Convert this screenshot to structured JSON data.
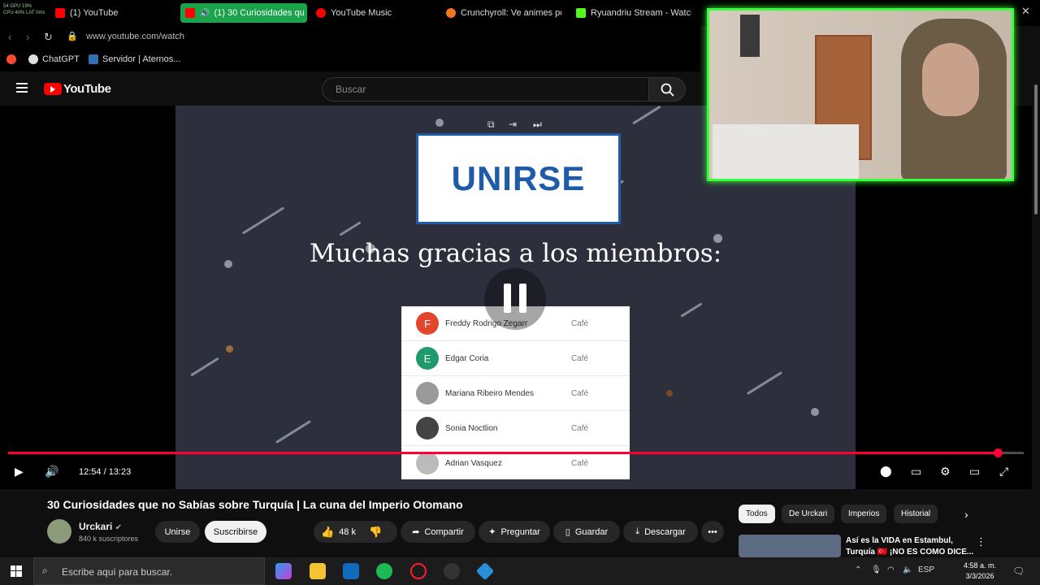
{
  "browser": {
    "tabs": [
      {
        "label": "(1) YouTube",
        "color": "#ff0000"
      },
      {
        "label": "(1) 30 Curiosidades qu",
        "color": "#ff0000",
        "active": true
      },
      {
        "label": "YouTube Music",
        "color": "#ff0000"
      },
      {
        "label": "Crunchyroll: Ve animes po",
        "color": "#f47521"
      },
      {
        "label": "Ryuandriu Stream - Watch",
        "color": "#53fc18"
      }
    ],
    "sysmon": [
      "54  GPU 19%",
      "CPU 40%  LAT 0ms"
    ],
    "url": "www.youtube.com/watch",
    "bookmarks": [
      "ChatGPT",
      "Servidor | Aternos..."
    ]
  },
  "youtube": {
    "logo_text": "YouTube",
    "search_placeholder": "Buscar"
  },
  "video": {
    "join_label": "UNIRSE",
    "thanks_text": "Muchas gracias a los miembros:",
    "members": [
      {
        "initial": "F",
        "name": "Freddy Rodrigo Zegarr",
        "tier": "Café",
        "color": "#e2462c"
      },
      {
        "initial": "E",
        "name": "Edgar Coria",
        "tier": "Café",
        "color": "#1f9a6d"
      },
      {
        "initial": "",
        "name": "Mariana Ribeiro Mendes",
        "tier": "Café",
        "color": "#9a9a9a"
      },
      {
        "initial": "",
        "name": "Sonia Noctlion",
        "tier": "Café",
        "color": "#444444"
      },
      {
        "initial": "",
        "name": "Adrian Vasquez",
        "tier": "Café",
        "color": "#bbbbbb"
      }
    ],
    "time": "12:54 / 13:23",
    "progress": 0.974
  },
  "info": {
    "title": "30 Curiosidades que no Sabías sobre Turquía | La cuna del Imperio Otomano",
    "channel": "Urckari",
    "subscribers": "840 k suscriptores",
    "join": "Unirse",
    "subscribe": "Suscribirse",
    "likes": "48 k",
    "share": "Compartir",
    "ask": "Preguntar",
    "save": "Guardar",
    "download": "Descargar"
  },
  "sidebar": {
    "chips": [
      "Todos",
      "De Urckari",
      "Imperios",
      "Historial"
    ],
    "rec_title": "Así es la VIDA en Estambul, Turquía 🇹🇷 ¡NO ES COMO DICE..."
  },
  "taskbar": {
    "search_placeholder": "Escribe aquí para buscar.",
    "lang": "ESP",
    "time": "4:58 a. m.",
    "date": "3/3/2026"
  }
}
